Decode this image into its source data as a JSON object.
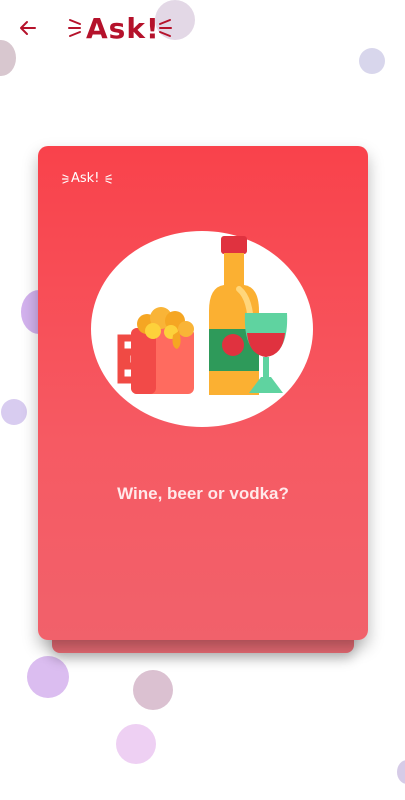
{
  "header": {
    "back_icon": "arrow-left-icon",
    "logo_text": "Ask!"
  },
  "card": {
    "logo_text": "Ask!",
    "illustration": "drinks-illustration",
    "question": "Wine, beer or vodka?"
  },
  "colors": {
    "accent": "#b5122b",
    "card_top": "#f9424b",
    "card_bottom": "#f1616b",
    "bubble": "#d9b8e8"
  }
}
